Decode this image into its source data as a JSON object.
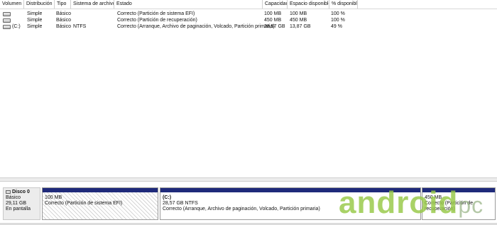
{
  "columns": [
    "Volumen",
    "Distribución",
    "Tipo",
    "Sistema de archivos",
    "Estado",
    "Capacidad",
    "Espacio disponible",
    "% disponible"
  ],
  "volumes": [
    {
      "volume": "",
      "layout": "Simple",
      "type": "Básico",
      "fs": "",
      "status": "Correcto (Partición de sistema EFI)",
      "capacity": "100 MB",
      "free": "100 MB",
      "pct": "100 %"
    },
    {
      "volume": "",
      "layout": "Simple",
      "type": "Básico",
      "fs": "",
      "status": "Correcto (Partición de recuperación)",
      "capacity": "450 MB",
      "free": "450 MB",
      "pct": "100 %"
    },
    {
      "volume": "(C:)",
      "layout": "Simple",
      "type": "Básico",
      "fs": "NTFS",
      "status": "Correcto (Arranque, Archivo de paginación, Volcado, Partición primaria)",
      "capacity": "28,57 GB",
      "free": "13,87 GB",
      "pct": "49 %"
    }
  ],
  "disk": {
    "name": "Disco 0",
    "type": "Básico",
    "size": "29,11 GB",
    "status": "En pantalla"
  },
  "partitions": [
    {
      "title": "",
      "size": "100 MB",
      "status": "Correcto (Partición de sistema EFI)"
    },
    {
      "title": "(C:)",
      "size": "28,57 GB NTFS",
      "status": "Correcto (Arranque, Archivo de paginación, Volcado, Partición primaria)"
    },
    {
      "title": "",
      "size": "450 MB",
      "status": "Correcto (Partición de recuperación)"
    }
  ],
  "watermark": {
    "main": "android",
    "suffix": "pc"
  },
  "colors": {
    "partition_bar": "#1f2a7a",
    "watermark_green": "#8cc63f"
  }
}
